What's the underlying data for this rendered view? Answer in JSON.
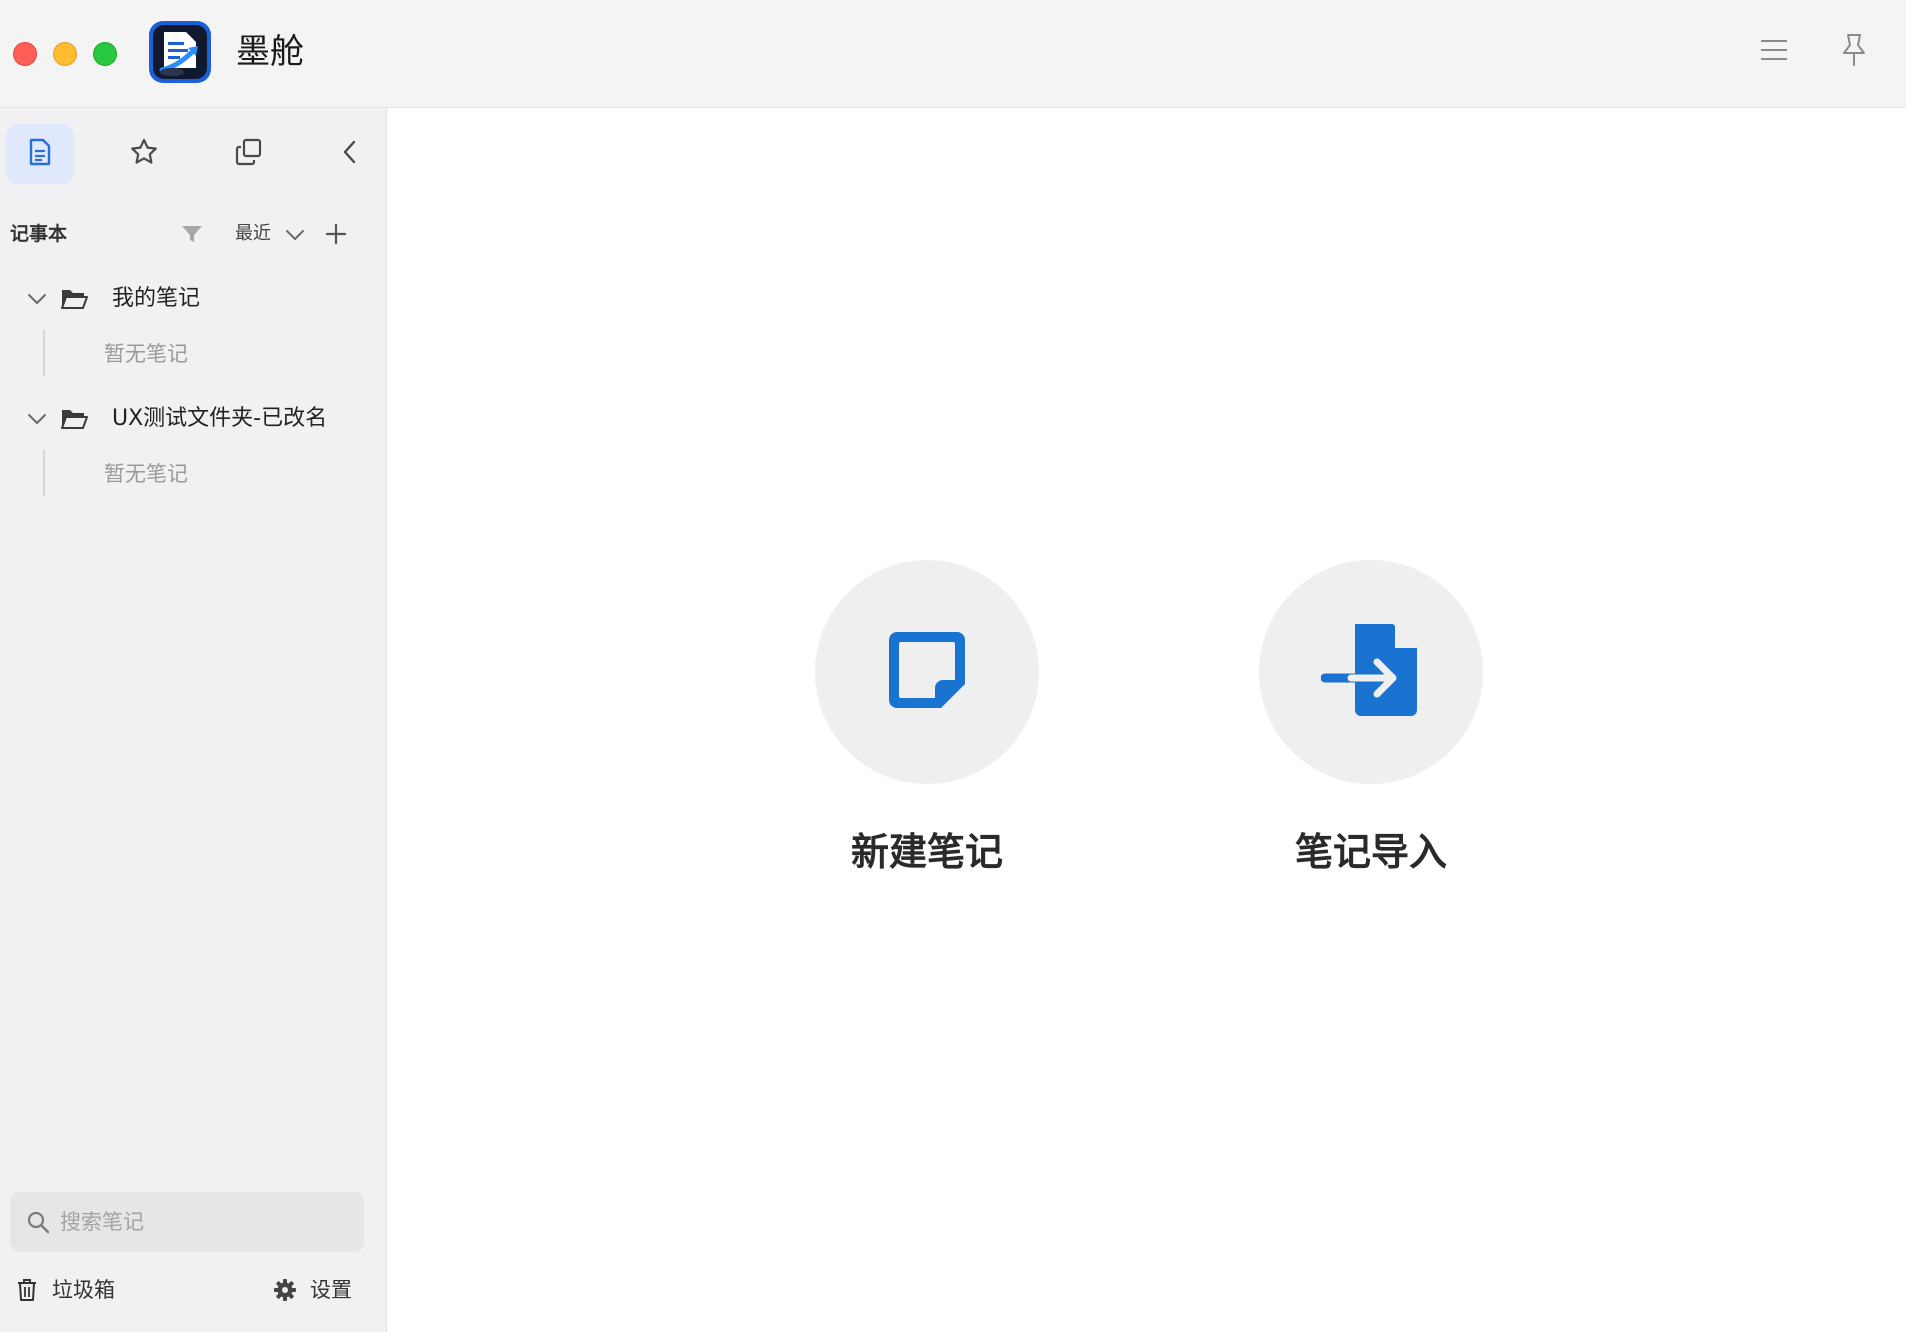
{
  "window": {
    "title": "墨舱",
    "controls": [
      "close",
      "minimize",
      "maximize"
    ],
    "toolbar_icons": [
      "menu-icon",
      "pin-icon"
    ]
  },
  "sidebar": {
    "tabs": [
      {
        "icon": "document-icon",
        "active": true
      },
      {
        "icon": "star-icon",
        "active": false
      },
      {
        "icon": "copy-icon",
        "active": false
      },
      {
        "icon": "chevron-left-icon",
        "active": false
      }
    ],
    "notebook_header": {
      "label": "记事本",
      "sort_label": "最近"
    },
    "folders": [
      {
        "name": "我的笔记",
        "empty_text": "暂无笔记",
        "expanded": true
      },
      {
        "name": "UX测试文件夹-已改名",
        "empty_text": "暂无笔记",
        "expanded": true
      }
    ],
    "search": {
      "placeholder": "搜索笔记",
      "value": ""
    },
    "footer": {
      "trash_label": "垃圾箱",
      "settings_label": "设置"
    }
  },
  "main": {
    "actions": [
      {
        "label": "新建笔记",
        "icon": "new-note-icon"
      },
      {
        "label": "笔记导入",
        "icon": "import-note-icon"
      }
    ]
  },
  "colors": {
    "accent": "#1a73d1",
    "sidebar_bg": "#f1f1f3",
    "active_tab_bg": "#dfe9fb"
  }
}
